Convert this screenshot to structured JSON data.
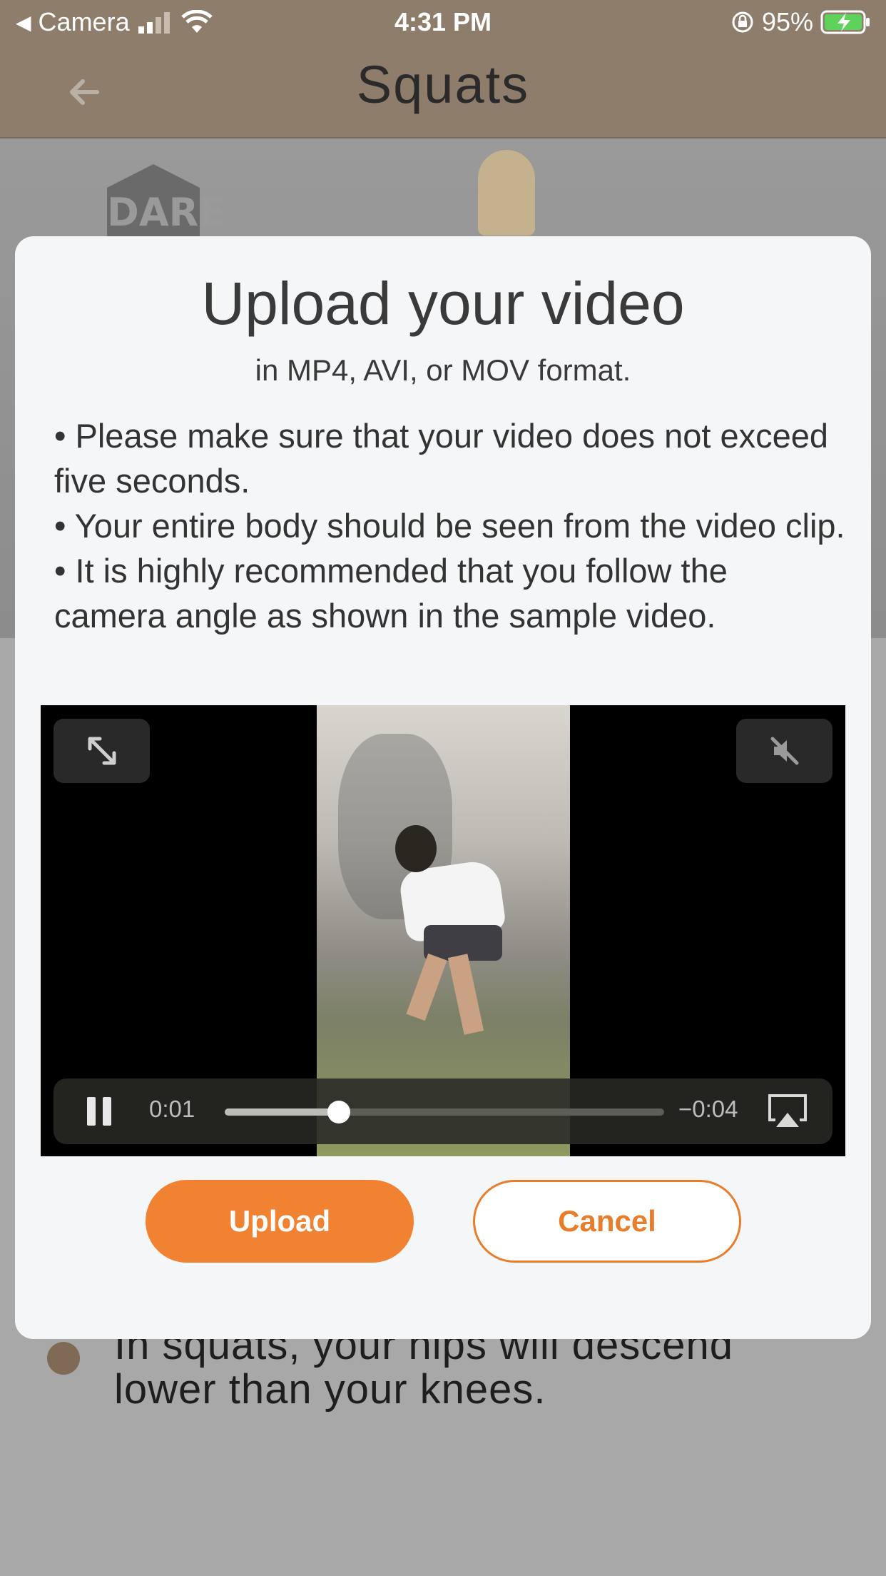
{
  "status_bar": {
    "back_app_label": "Camera",
    "time": "4:31 PM",
    "battery_percent": "95%"
  },
  "header": {
    "title": "Squats"
  },
  "background": {
    "logo_text": "DARE",
    "bullet_text": "In squats, your hips will descend lower than your knees."
  },
  "modal": {
    "title": "Upload your video",
    "subtitle": "in MP4, AVI, or MOV format.",
    "instructions": [
      "• Please make sure that your video does not exceed five seconds.",
      "• Your entire body should be seen from the video clip.",
      "• It is highly recommended that you follow the camera angle as shown in the sample video."
    ],
    "player": {
      "time_elapsed": "0:01",
      "time_remaining": "−0:04",
      "progress_fraction": 0.26,
      "muted": true,
      "playing": true
    },
    "upload_label": "Upload",
    "cancel_label": "Cancel"
  },
  "colors": {
    "accent": "#f08232",
    "header_bg": "#8f7d6c",
    "overlay_bg": "#a8a8a8"
  }
}
